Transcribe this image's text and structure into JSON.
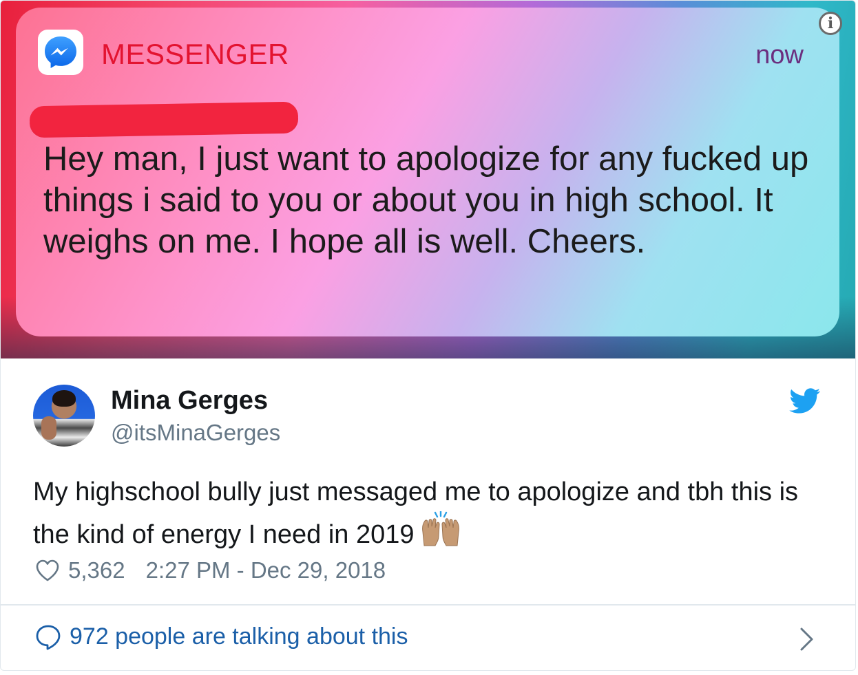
{
  "notification": {
    "app_name": "MESSENGER",
    "time": "now",
    "message": "Hey man, I just want to apologize for any fucked up things i said to you or about you in high school. It weighs on me. I hope all is well. Cheers."
  },
  "tweet": {
    "author_name": "Mina Gerges",
    "author_handle": "@itsMinaGerges",
    "text": "My highschool bully just messaged me to apologize and tbh this is the kind of energy I need in 2019",
    "likes": "5,362",
    "timestamp": "2:27 PM - Dec 29, 2018",
    "talking": "972 people are talking about this"
  },
  "icons": {
    "app": "messenger-icon",
    "info": "info-icon",
    "brand": "twitter-icon",
    "like": "heart-icon",
    "reply": "speech-bubble-icon",
    "more": "chevron-right-icon",
    "emoji": "raising-hands-emoji"
  },
  "colors": {
    "twitter_blue": "#1da1f2",
    "link_blue": "#1b5fa8",
    "messenger_red": "#e31330",
    "secondary_text": "#657786"
  }
}
